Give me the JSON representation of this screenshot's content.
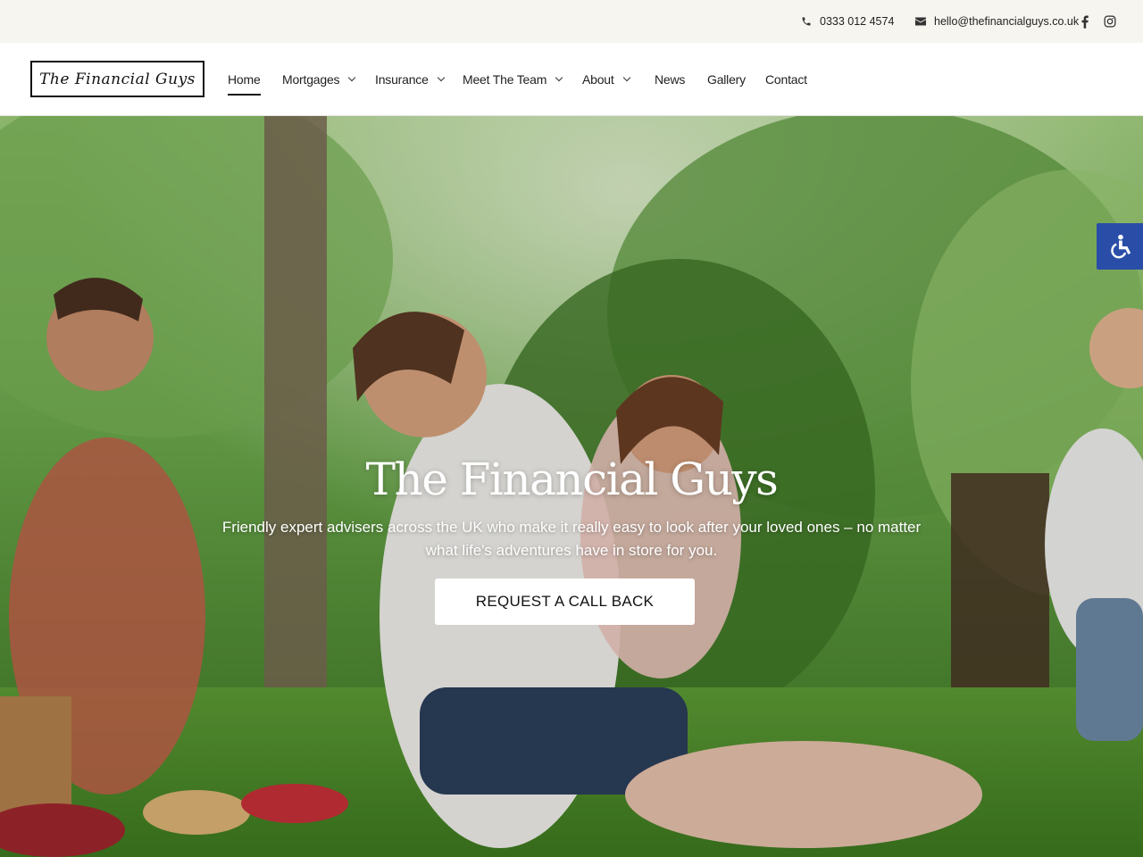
{
  "topbar": {
    "phone": "0333 012 4574",
    "email": "hello@thefinancialguys.co.uk",
    "social": [
      "facebook-icon",
      "instagram-icon"
    ]
  },
  "header": {
    "logo_text": "The Financial Guys",
    "nav": [
      {
        "label": "Home",
        "dropdown": false,
        "active": true
      },
      {
        "label": "Mortgages",
        "dropdown": true
      },
      {
        "label": "Insurance",
        "dropdown": true
      },
      {
        "label": "Meet The Team",
        "dropdown": true
      },
      {
        "label": "About",
        "dropdown": true
      },
      {
        "label": "News",
        "dropdown": false
      },
      {
        "label": "Gallery",
        "dropdown": false
      },
      {
        "label": "Contact",
        "dropdown": false
      }
    ]
  },
  "hero": {
    "title": "The Financial Guys",
    "subtitle": "Friendly expert advisers across the UK who make it really easy to look after your loved ones – no matter what life's adventures have in store for you.",
    "cta_label": "REQUEST A CALL BACK"
  },
  "colors": {
    "topbar_bg": "#f7f5f0",
    "accessibility_bg": "#2a4ea8",
    "text": "#1a1a1a"
  }
}
